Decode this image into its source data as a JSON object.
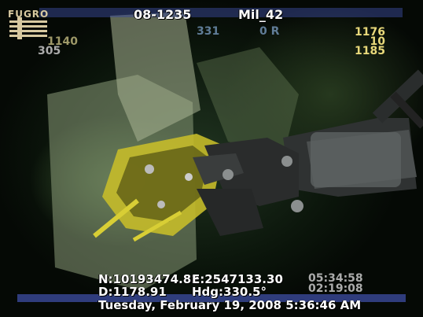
{
  "overlay": {
    "top_left_id": "08-1235",
    "top_right_id": "Mil_42",
    "heading_value": "331",
    "pitch_value": "0 R",
    "left_top": "1140",
    "left_bottom": "305",
    "right_top": "1176",
    "right_mid": "10",
    "right_bottom": "1185",
    "northing": "N:10193474.82",
    "easting": "E:2547133.30",
    "depth": "D:1178.91",
    "heading": "Hdg:330.5°",
    "time_top": "05:34:58",
    "time_bottom": "02:19:08",
    "datetime": "Tuesday, February 19, 2008 5:36:46 AM"
  },
  "logo": {
    "text": "FUGRO"
  }
}
